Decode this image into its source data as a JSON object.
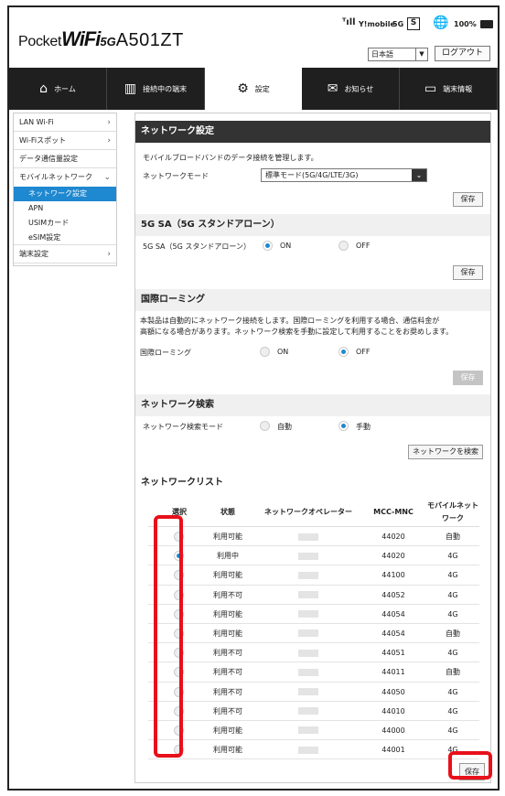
{
  "header": {
    "brand": {
      "pocket": "Pocket",
      "wifi": "WiFi",
      "fiveg": "5G",
      "model": "A501ZT"
    },
    "signal": "ᵀıll",
    "carrier": "Y!mobile",
    "network": "5G",
    "sim": "S",
    "globe": "🌐",
    "battery": "100%",
    "language": "日本語",
    "logout": "ログアウト"
  },
  "nav": [
    {
      "label": "ホーム",
      "icon": "⌂"
    },
    {
      "label": "接続中の端末",
      "icon": "▥"
    },
    {
      "label": "設定",
      "icon": "⚙"
    },
    {
      "label": "お知らせ",
      "icon": "✉"
    },
    {
      "label": "端末情報",
      "icon": "▭"
    }
  ],
  "sidebar": {
    "lan": "LAN Wi-Fi",
    "wifispot": "Wi-Fiスポット",
    "datausage": "データ通信量設定",
    "mobile": "モバイルネットワーク",
    "sub": [
      "ネットワーク設定",
      "APN",
      "USIMカード",
      "eSIM設定"
    ],
    "device": "端末設定",
    "chev_right": "›",
    "chev_down": "⌄"
  },
  "network_settings": {
    "title": "ネットワーク設定",
    "desc": "モバイルブロードバンドのデータ接続を管理します。",
    "mode_label": "ネットワークモード",
    "mode_value": "標準モード(5G/4G/LTE/3G)",
    "save": "保存"
  },
  "sa": {
    "title": "5G SA（5G スタンドアローン）",
    "label": "5G SA（5G スタンドアローン）",
    "on": "ON",
    "off": "OFF",
    "save": "保存"
  },
  "roaming": {
    "title": "国際ローミング",
    "desc1": "本製品は自動的にネットワーク接続をします。国際ローミングを利用する場合、通信料金が",
    "desc2": "高額になる場合があります。ネットワーク検索を手動に設定して利用することをお奨めします。",
    "label": "国際ローミング",
    "on": "ON",
    "off": "OFF",
    "save": "保存"
  },
  "search": {
    "title": "ネットワーク検索",
    "label": "ネットワーク検索モード",
    "auto": "自動",
    "manual": "手動",
    "button": "ネットワークを検索"
  },
  "netlist": {
    "title": "ネットワークリスト",
    "headers": [
      "選択",
      "状態",
      "ネットワークオペレーター",
      "MCC-MNC",
      "モバイルネット",
      "ワーク"
    ],
    "rows": [
      {
        "status": "利用可能",
        "mcc": "44020",
        "type": "自動",
        "selected": false
      },
      {
        "status": "利用中",
        "mcc": "44020",
        "type": "4G",
        "selected": true
      },
      {
        "status": "利用可能",
        "mcc": "44100",
        "type": "4G",
        "selected": false
      },
      {
        "status": "利用不可",
        "mcc": "44052",
        "type": "4G",
        "selected": false
      },
      {
        "status": "利用可能",
        "mcc": "44054",
        "type": "4G",
        "selected": false
      },
      {
        "status": "利用可能",
        "mcc": "44054",
        "type": "自動",
        "selected": false
      },
      {
        "status": "利用不可",
        "mcc": "44051",
        "type": "4G",
        "selected": false
      },
      {
        "status": "利用不可",
        "mcc": "44011",
        "type": "自動",
        "selected": false
      },
      {
        "status": "利用不可",
        "mcc": "44050",
        "type": "4G",
        "selected": false
      },
      {
        "status": "利用不可",
        "mcc": "44010",
        "type": "4G",
        "selected": false
      },
      {
        "status": "利用可能",
        "mcc": "44000",
        "type": "4G",
        "selected": false
      },
      {
        "status": "利用可能",
        "mcc": "44001",
        "type": "4G",
        "selected": false
      }
    ],
    "save": "保存"
  },
  "colors": {
    "accent": "#1e88d0",
    "highlight": "#e8101a",
    "nav_bg": "#1f1f1f"
  }
}
